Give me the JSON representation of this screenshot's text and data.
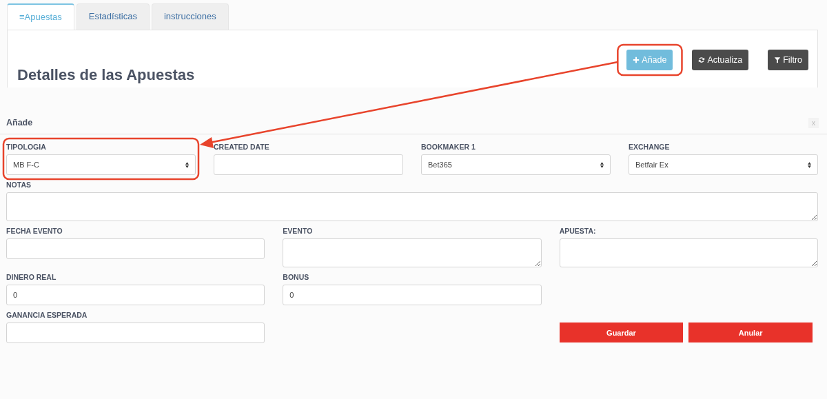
{
  "tabs": [
    {
      "label": "≡Apuestas",
      "selected": true
    },
    {
      "label": "Estadísticas",
      "selected": false
    },
    {
      "label": "instrucciones",
      "selected": false
    }
  ],
  "page_title": "Detalles de las Apuestas",
  "toolbar": [
    {
      "label": "Añade",
      "kind": "add"
    },
    {
      "label": "Actualiza",
      "kind": "refresh"
    },
    {
      "label": "Filtro",
      "kind": "filter"
    }
  ],
  "modal": {
    "title": "Añade",
    "close": "x",
    "rows": [
      [
        {
          "label": "TIPOLOGIA",
          "kind": "select",
          "value": "MB F-C"
        },
        {
          "label": "CREATED DATE",
          "kind": "input"
        },
        {
          "label": "BOOKMAKER 1",
          "kind": "select",
          "value": "Bet365"
        },
        {
          "label": "EXCHANGE",
          "kind": "select",
          "value": "Betfair Ex"
        }
      ],
      [
        {
          "label": "NOTAS",
          "kind": "textarea"
        }
      ],
      [
        {
          "label": "FECHA EVENTO",
          "kind": "input"
        },
        {
          "label": "EVENTO",
          "kind": "textarea"
        },
        {
          "label": "APUESTA:",
          "kind": "textarea"
        }
      ],
      [
        {
          "label": "DINERO REAL",
          "kind": "input",
          "value": "0"
        },
        {
          "label": "BONUS",
          "kind": "input",
          "value": "0"
        }
      ]
    ],
    "last_field": {
      "label": "GANANCIA ESPERADA",
      "kind": "input"
    },
    "buttons": [
      "Guardar",
      "Anular"
    ]
  }
}
